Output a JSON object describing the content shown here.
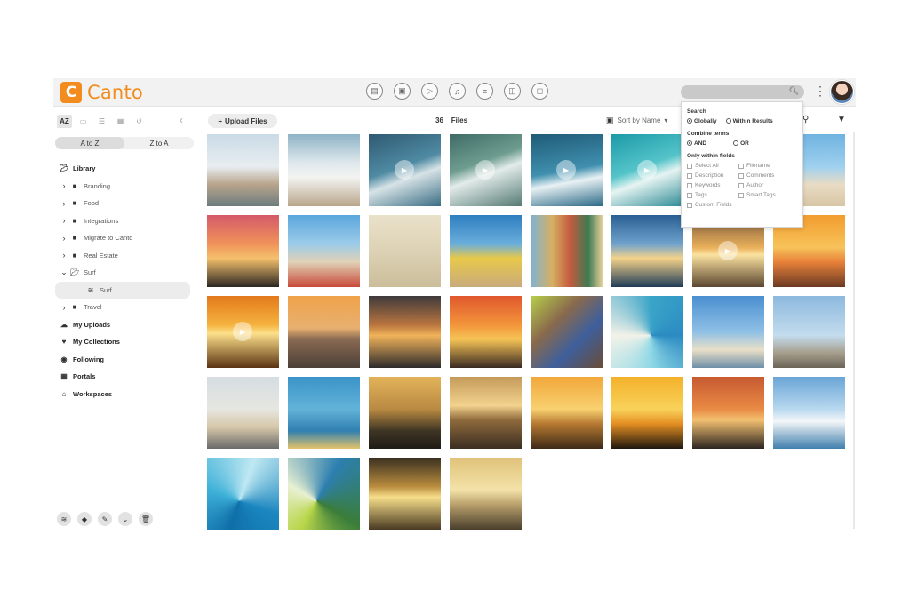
{
  "header": {
    "brand": "Canto",
    "brand_color": "#f28c1e",
    "type_icons": [
      "document-icon",
      "image-icon",
      "video-play-icon",
      "audio-icon",
      "text-document-icon",
      "presentation-icon",
      "other-file-icon"
    ],
    "search": {
      "value": "",
      "icon": "search-icon"
    },
    "more_icon": "kebab-icon",
    "avatar": "user-avatar"
  },
  "sidebar": {
    "view_tabs": [
      "AZ"
    ],
    "sort_options": [
      "A to Z",
      "Z to A"
    ],
    "selected_sort": "A to Z",
    "tree": [
      {
        "label": "Library",
        "level": 0,
        "bold": true,
        "icon": "folder-open-icon"
      },
      {
        "label": "Branding",
        "level": 1,
        "arrow": "›",
        "icon": "folder-icon"
      },
      {
        "label": "Food",
        "level": 1,
        "arrow": "›",
        "icon": "folder-icon"
      },
      {
        "label": "Integrations",
        "level": 1,
        "arrow": "›",
        "icon": "folder-icon"
      },
      {
        "label": "Migrate to Canto",
        "level": 1,
        "arrow": "›",
        "icon": "folder-icon"
      },
      {
        "label": "Real Estate",
        "level": 1,
        "arrow": "›",
        "icon": "folder-icon"
      },
      {
        "label": "Surf",
        "level": 1,
        "arrow": "⌄",
        "icon": "folder-open-icon"
      },
      {
        "label": "Surf",
        "level": 2,
        "selected": true,
        "icon": "album-icon"
      },
      {
        "label": "Travel",
        "level": 1,
        "arrow": "›",
        "icon": "folder-icon"
      },
      {
        "label": "My Uploads",
        "level": 0,
        "bold": true,
        "icon": "upload-cloud-icon"
      },
      {
        "label": "My Collections",
        "level": 0,
        "bold": true,
        "icon": "heart-icon"
      },
      {
        "label": "Following",
        "level": 0,
        "bold": true,
        "icon": "eye-icon"
      },
      {
        "label": "Portals",
        "level": 0,
        "bold": true,
        "icon": "grid-icon"
      },
      {
        "label": "Workspaces",
        "level": 0,
        "bold": true,
        "icon": "workspace-icon"
      }
    ],
    "bottom_tools": [
      "stack-icon",
      "tag-icon",
      "edit-icon",
      "chevron-down-icon",
      "trash-icon"
    ]
  },
  "toolbar": {
    "upload_label": "Upload Files",
    "file_count": "36",
    "files_label": "Files",
    "sort_label": "Sort by Name"
  },
  "search_dropdown": {
    "search_heading": "Search",
    "scope_options": [
      "Globally",
      "Within Results"
    ],
    "scope_selected": "Globally",
    "combine_heading": "Combine terms",
    "combine_options": [
      "AND",
      "OR"
    ],
    "combine_selected": "AND",
    "fields_heading": "Only within fields",
    "fields": [
      "Select All",
      "Filename",
      "Description",
      "Comments",
      "Keywords",
      "Author",
      "Tags",
      "Smart Tags",
      "Custom Fields"
    ]
  },
  "grid": {
    "tiles": [
      {
        "scene": "surfer-walking-shore",
        "video": false
      },
      {
        "scene": "surfer-entering-waves",
        "video": false
      },
      {
        "scene": "surfer-wave-blue",
        "video": true
      },
      {
        "scene": "wave-curl-green",
        "video": true
      },
      {
        "scene": "ocean-wave-teal",
        "video": true
      },
      {
        "scene": "surfer-wave-turquoise",
        "video": true
      },
      {
        "scene": "search-hidden-tile",
        "video": false
      },
      {
        "scene": "lifeguard-hut-beach",
        "video": false
      },
      {
        "scene": "friends-sunset-beach",
        "video": false
      },
      {
        "scene": "surfboards-fence",
        "video": false
      },
      {
        "scene": "beach-walkers",
        "video": false
      },
      {
        "scene": "surfboards-palms",
        "video": false
      },
      {
        "scene": "surfboard-rack",
        "video": false
      },
      {
        "scene": "surfboard-bag-sunset",
        "video": false
      },
      {
        "scene": "sunset-ocean-video",
        "video": true
      },
      {
        "scene": "sunset-coast-rocks",
        "video": false
      },
      {
        "scene": "beach-sunset-people",
        "video": true
      },
      {
        "scene": "bridge-sunset",
        "video": false
      },
      {
        "scene": "ocean-sunset-clouds",
        "video": false
      },
      {
        "scene": "pier-sunset-palms",
        "video": false
      },
      {
        "scene": "tennis-ball-sneakers",
        "video": false
      },
      {
        "scene": "wave-curl-aqua",
        "video": false
      },
      {
        "scene": "palm-trees-pier",
        "video": false
      },
      {
        "scene": "palm-trees-sky",
        "video": false
      },
      {
        "scene": "motorcycle-beach",
        "video": false
      },
      {
        "scene": "surfer-yellow-board",
        "video": false
      },
      {
        "scene": "surfer-silhouette",
        "video": false
      },
      {
        "scene": "golden-ocean-waves",
        "video": false
      },
      {
        "scene": "silhouette-sunset-shore",
        "video": false
      },
      {
        "scene": "camel-silhouette-sunset",
        "video": false
      },
      {
        "scene": "pier-palms-dusk",
        "video": false
      },
      {
        "scene": "coastline-blue",
        "video": false
      },
      {
        "scene": "surfer-barrel-wave",
        "video": false
      },
      {
        "scene": "surfer-green-wave",
        "video": false
      },
      {
        "scene": "yoga-sunset",
        "video": false
      },
      {
        "scene": "runner-beach-sunset",
        "video": false
      }
    ]
  }
}
